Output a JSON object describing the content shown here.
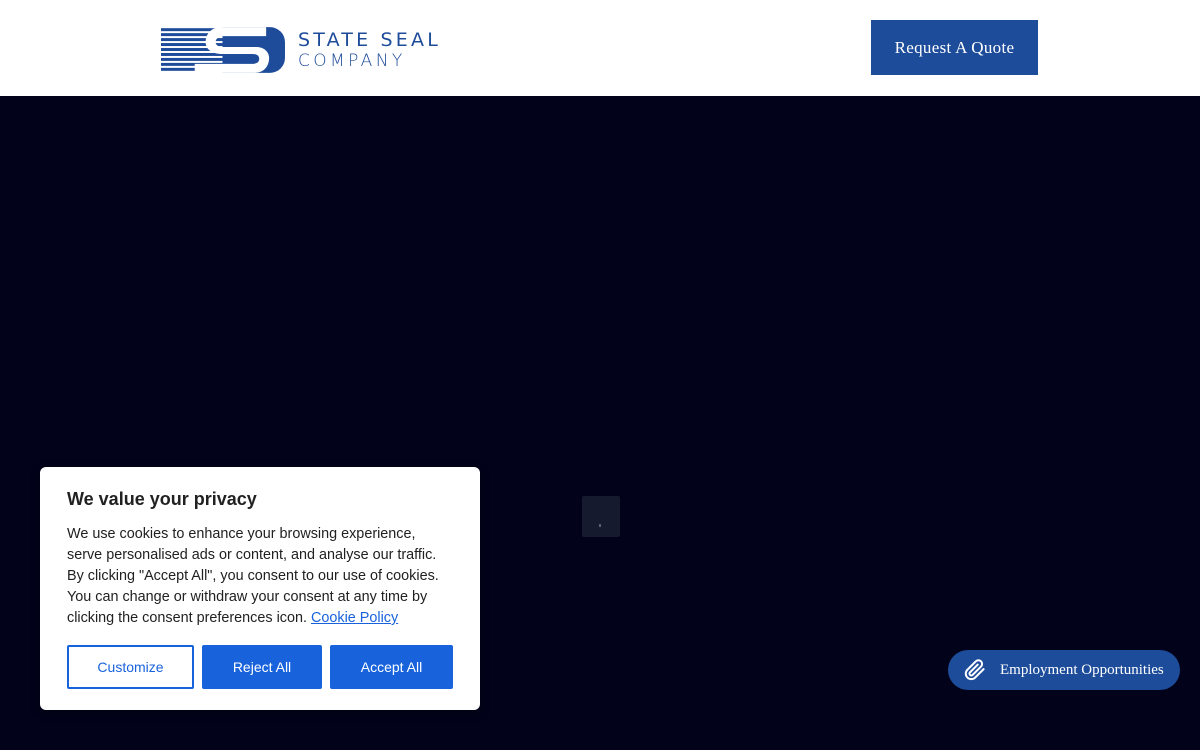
{
  "brand": {
    "name_line1": "STATE SEAL",
    "name_line2": "COMPANY",
    "color": "#1e4c9a"
  },
  "header": {
    "quote_button_label": "Request A Quote"
  },
  "cookie_banner": {
    "title": "We value your privacy",
    "body": "We use cookies to enhance your browsing experience, serve personalised ads or content, and analyse our traffic. By clicking \"Accept All\", you consent to our use of cookies. You can change or withdraw your consent at any time by clicking the consent preferences icon.",
    "policy_link_label": "Cookie Policy",
    "customize_label": "Customize",
    "reject_label": "Reject All",
    "accept_label": "Accept All",
    "accent_color": "#1863dc"
  },
  "employment_button": {
    "label": "Employment Opportunities",
    "icon": "paperclip-icon"
  },
  "hero": {
    "background_color": "#02021a"
  }
}
